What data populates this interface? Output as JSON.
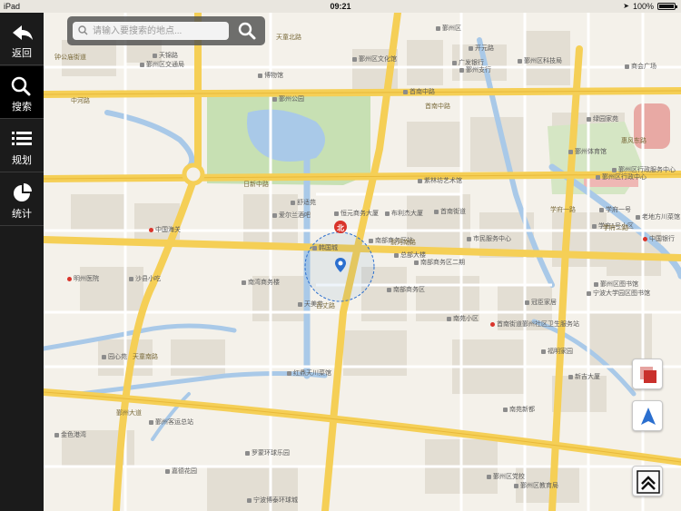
{
  "status_bar": {
    "device": "iPad",
    "time": "09:21",
    "battery": "100%"
  },
  "sidebar": {
    "items": [
      {
        "label": "返回",
        "icon": "back-arrow-icon"
      },
      {
        "label": "搜索",
        "icon": "search-icon"
      },
      {
        "label": "规划",
        "icon": "list-icon"
      },
      {
        "label": "统计",
        "icon": "pie-chart-icon"
      }
    ]
  },
  "search": {
    "placeholder": "请输入要搜索的地点..."
  },
  "map": {
    "compass_label": "北",
    "roads": [
      "日新中路",
      "鄞州大道",
      "天童南路",
      "学府一路",
      "首南中路",
      "百丈路",
      "天童北路",
      "学府二路",
      "中河路",
      "前河南路",
      "惠风东路",
      "钟公庙街道"
    ],
    "pois": [
      "博物馆",
      "鄞州区交通局",
      "天锦路",
      "鄞州公园",
      "鄞州区文化馆",
      "鄞州区科技局",
      "广发银行",
      "鄞州支行",
      "鄞州区",
      "开元路",
      "商会广场",
      "绿园家苑",
      "鄞州体育馆",
      "鄞州区行政服务中心",
      "学府一号",
      "老地方川菜馆",
      "中国银行",
      "学府1号小区",
      "鄞州区图书馆",
      "宁波大学园区图书馆",
      "首南中路",
      "舒适苑",
      "爱尔兰酒吧",
      "紫林坊艺术馆",
      "恒元商务大厦",
      "首南街道",
      "南部商务区站",
      "市民服务中心",
      "布利杰大厦",
      "中国海关",
      "总部大楼",
      "鄞州区行政中心",
      "明州医院",
      "沙县小吃",
      "韩国城",
      "南部商务区",
      "南部商务区二期",
      "天美苑",
      "南湾商务楼",
      "首南街道鄞州社区卫生服务站",
      "南苑小区",
      "冠臣家居",
      "园心苑",
      "红鼎天川菜馆",
      "鄞州客运总站",
      "金色港湾",
      "罗蒙环球乐园",
      "嘉德花园",
      "宁波博泰环球城",
      "南苑新都",
      "鄞州区党校",
      "鄞州区教育局",
      "福明家园",
      "新吉大厦"
    ]
  },
  "controls": {
    "layers": "layers-icon",
    "locate": "locate-arrow-icon",
    "top": "scroll-top-icon"
  },
  "colors": {
    "sidebar_bg": "#1b1b1b",
    "map_bg": "#f4f1ea",
    "road_major": "#f5cf56",
    "road_minor": "#ffffff",
    "water": "#a9c9e8",
    "park": "#c7e0b3",
    "building": "#e2ddd3",
    "accent_blue": "#2b6fcf",
    "accent_red": "#d9342b"
  }
}
